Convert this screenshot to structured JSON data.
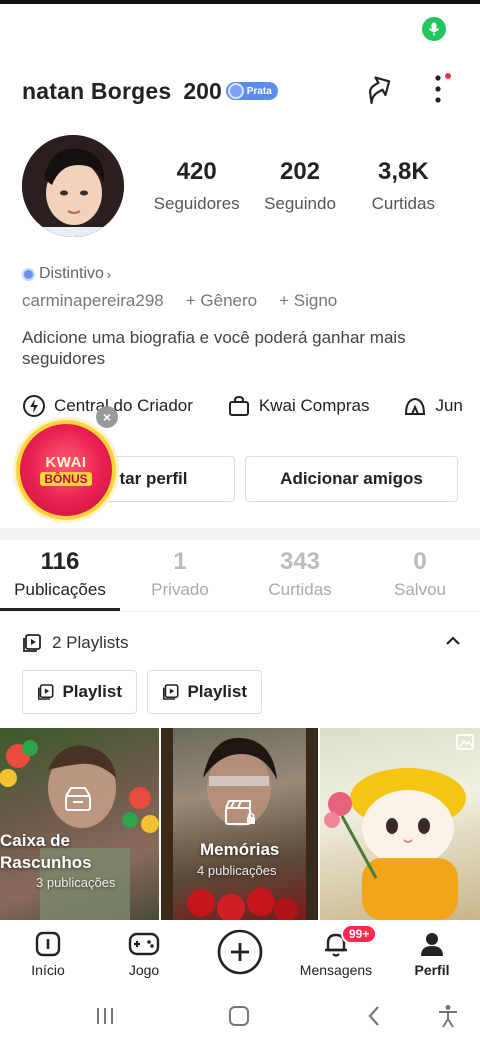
{
  "profile": {
    "username": "natan Borges",
    "level": "200",
    "badge_label": "Prata",
    "handle": "carminapereira298",
    "distintivo": "Distintivo",
    "genero": "+ Gênero",
    "signo": "+ Signo",
    "bio": "Adicione uma biografia e você poderá ganhar mais seguidores"
  },
  "stats": [
    {
      "num": "420",
      "label": "Seguidores"
    },
    {
      "num": "202",
      "label": "Seguindo"
    },
    {
      "num": "3,8K",
      "label": "Curtidas"
    }
  ],
  "links": [
    {
      "label": "Central do Criador",
      "icon": "bolt-circle-icon"
    },
    {
      "label": "Kwai Compras",
      "icon": "shopping-bag-icon"
    },
    {
      "label": "Jun",
      "icon": "tent-icon"
    }
  ],
  "buttons": {
    "edit": "Editar perfil",
    "edit_visible": "tar perfil",
    "add_friends": "Adicionar amigos"
  },
  "bonus": {
    "line1": "KWAI",
    "line2": "BÔNUS",
    "close": "×"
  },
  "tabs": [
    {
      "num": "116",
      "label": "Publicações",
      "active": true
    },
    {
      "num": "1",
      "label": "Privado",
      "active": false
    },
    {
      "num": "343",
      "label": "Curtidas",
      "active": false
    },
    {
      "num": "0",
      "label": "Salvou",
      "active": false
    }
  ],
  "playlists": {
    "header": "2 Playlists",
    "items": [
      "Playlist",
      "Playlist"
    ]
  },
  "grid": [
    {
      "title": "Caixa de Rascunhos",
      "title_l1": "Caixa de",
      "title_l2": "Rascunhos",
      "sub": "3 publicações"
    },
    {
      "title": "Memórias",
      "sub": "4 publicações"
    },
    {
      "title": "",
      "sub": ""
    }
  ],
  "nav": [
    {
      "label": "Início",
      "icon": "home-icon"
    },
    {
      "label": "Jogo",
      "icon": "gamepad-icon"
    },
    {
      "label": "",
      "icon": "plus-circle-icon"
    },
    {
      "label": "Mensagens",
      "icon": "bell-icon"
    },
    {
      "label": "Perfil",
      "icon": "person-icon"
    }
  ],
  "messages_badge": "99+",
  "colors": {
    "accent": "#ff2a4d",
    "prata": "#5b8def",
    "mic": "#22c55e",
    "bonus_gold": "#ffd43b"
  }
}
